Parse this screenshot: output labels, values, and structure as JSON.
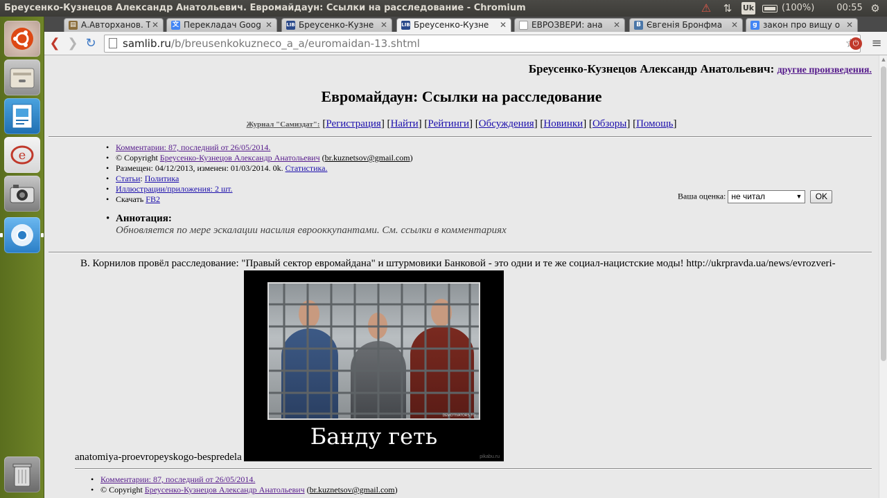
{
  "system": {
    "window_title": "Бреусенко-Кузнецов Александр Анатольевич. Евромайдаун: Ссылки на расследование - Chromium",
    "keyboard_layout": "Uk",
    "battery": "(100%)",
    "clock": "00:55"
  },
  "launcher": {
    "items": [
      "ubuntu-dash",
      "files",
      "libreoffice-impress",
      "help",
      "camera",
      "chromium",
      "trash"
    ]
  },
  "tabs": [
    {
      "label": "А.Авторханов. Те",
      "icon": "book-icon",
      "active": false
    },
    {
      "label": "Перекладач Goog",
      "icon": "translate-icon",
      "active": false
    },
    {
      "label": "Бреусенко-Кузне",
      "icon": "samlib-icon",
      "active": false
    },
    {
      "label": "Бреусенко-Кузне",
      "icon": "samlib-icon",
      "active": true
    },
    {
      "label": "ЕВРОЗВЕРИ: ана",
      "icon": "page-icon",
      "active": false
    },
    {
      "label": "Євгенія Бронфма",
      "icon": "vk-icon",
      "active": false
    },
    {
      "label": "закон про вищу о",
      "icon": "google-icon",
      "active": false
    }
  ],
  "address": {
    "host": "samlib.ru",
    "path": "/b/breusenkokuzneco_a_a/euromaidan-13.shtml"
  },
  "page": {
    "author": "Бреусенко-Кузнецов Александр Анатольевич:",
    "other_works": "другие произведения.",
    "title": "Евромайдаун: Ссылки на расследование",
    "journal_label": "Журнал \"Самиздат\":",
    "journal_links": [
      "Регистрация",
      "Найти",
      "Рейтинги",
      "Обсуждения",
      "Новинки",
      "Обзоры",
      "Помощь"
    ],
    "info": {
      "comments": "Комментарии: 87, последний от 26/05/2014.",
      "copyright_prefix": "© Copyright",
      "copyright_author": "Бреусенко-Кузнецов Александр Анатольевич",
      "email": "br.kuznetsov@gmail.com",
      "posted": "Размещен: 04/12/2013, изменен: 01/03/2014. 0k.",
      "statistics": "Статистика.",
      "category_link": "Статьи",
      "genre_link": "Политика",
      "illustrations": "Иллюстрации/приложения: 2 шт.",
      "download_label": "Скачать",
      "download_link": "FB2"
    },
    "annotation_label": "Аннотация:",
    "annotation_text": "Обновляется по мере эскалации насилия еврооккупантами. См. ссылки в комментариях",
    "rating_label": "Ваша оценка:",
    "rating_value": "не читал",
    "ok_label": "OK",
    "body_text": "В. Корнилов провёл расследование: \"Правый сектор евромайдана\" и штурмовики Банковой - это одни и те же социал-нацистские моды! http://ukrpravda.ua/news/evrozveri-",
    "body_tail": "anatomiya-proevropeyskogo-bespredela",
    "image_caption": "Банду геть",
    "image_site": "pikabu.ru",
    "image_watermark": "DEMOTIVATORS.TO"
  }
}
